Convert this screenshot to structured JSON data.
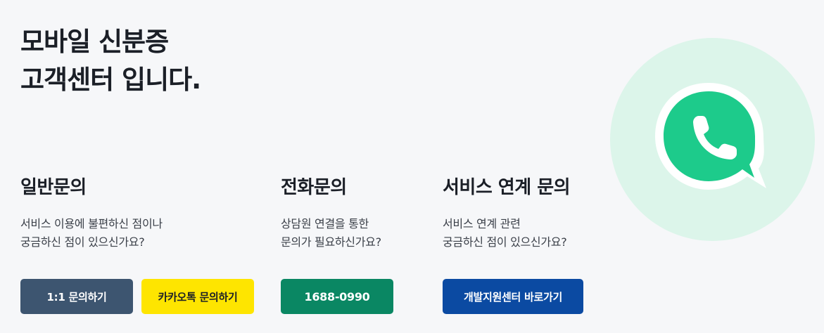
{
  "hero": {
    "line1": "모바일 신분증",
    "line2": "고객센터 입니다."
  },
  "sections": {
    "general": {
      "title": "일반문의",
      "desc_line1": "서비스 이용에 불편하신 점이나",
      "desc_line2": "궁금하신 점이 있으신가요?",
      "btn_1to1": "1:1 문의하기",
      "btn_kakao": "카카오톡 문의하기"
    },
    "phone": {
      "title": "전화문의",
      "desc_line1": "상담원 연결을 통한",
      "desc_line2": "문의가 필요하신가요?",
      "btn_phone": "1688-0990"
    },
    "service": {
      "title": "서비스 연계 문의",
      "desc_line1": "서비스 연계 관련",
      "desc_line2": "궁금하신 점이 있으신가요?",
      "btn_dev": "개발지원센터 바로가기"
    }
  },
  "icons": {
    "illustration": "phone-chat-bubble-icon"
  },
  "colors": {
    "btn_1to1_bg": "#3d5570",
    "btn_kakao_bg": "#fee500",
    "btn_phone_bg": "#0a8763",
    "btn_dev_bg": "#0b4aa2",
    "hero_circle": "#dcf5ea",
    "bubble_green": "#1dcb8b"
  }
}
